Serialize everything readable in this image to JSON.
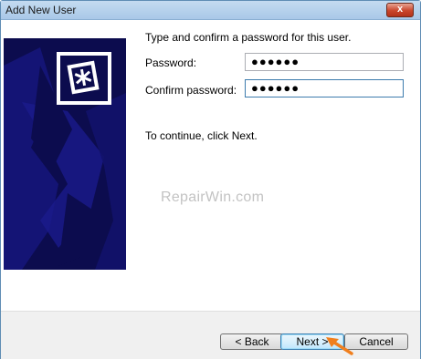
{
  "window": {
    "title": "Add New User",
    "close_label": "x"
  },
  "instructions": "Type and confirm a password for this user.",
  "password": {
    "label": "Password:",
    "value": "●●●●●●"
  },
  "confirm_password": {
    "label": "Confirm password:",
    "value": "●●●●●●"
  },
  "continue_text": "To continue, click Next.",
  "watermark": "RepairWin.com",
  "buttons": {
    "back": "< Back",
    "next": "Next >",
    "cancel": "Cancel"
  },
  "colors": {
    "banner": "#0c0c4e",
    "accent_arrow": "#f07f1e"
  }
}
